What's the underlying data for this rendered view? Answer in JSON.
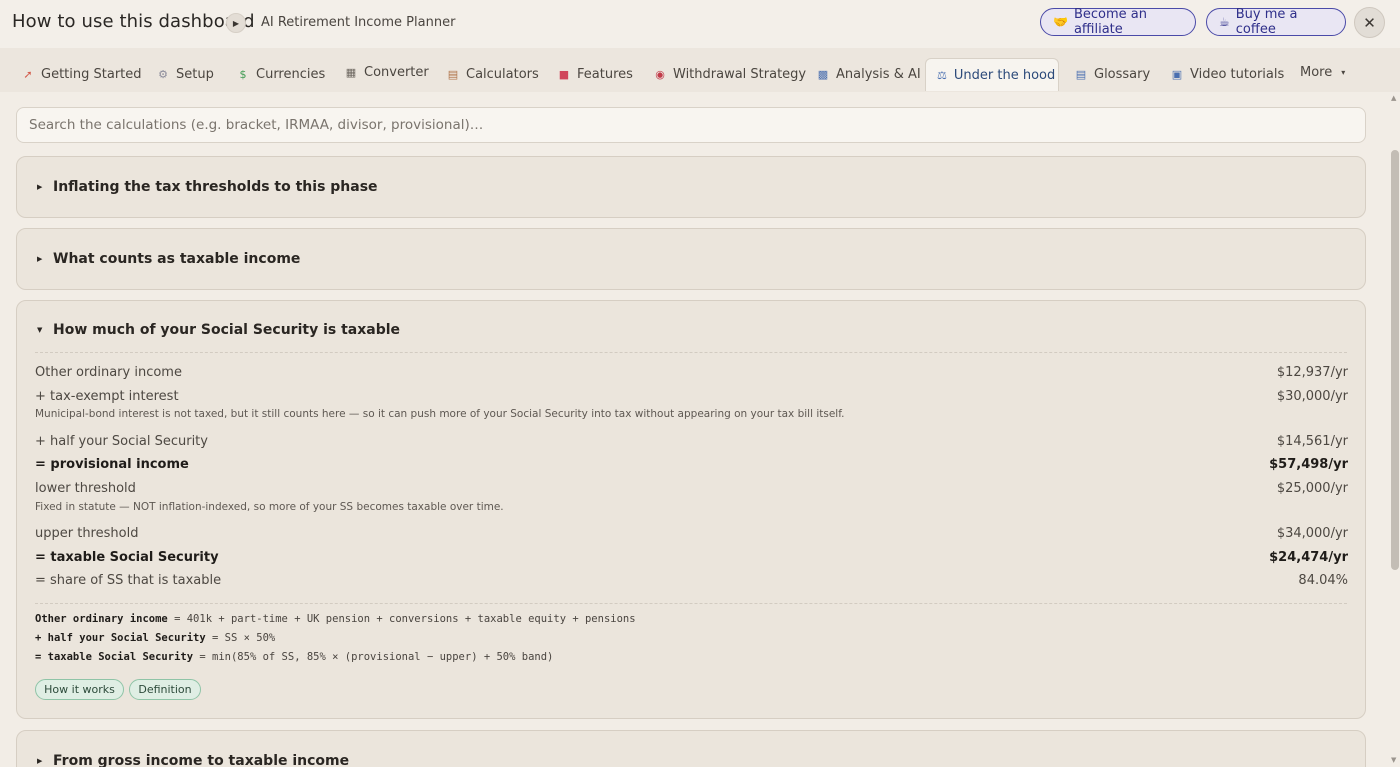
{
  "header": {
    "title": "How to use this dashboard",
    "subtitle": "AI Retirement Income Planner",
    "affiliate_label": "Become an affiliate",
    "coffee_label": "Buy me a coffee"
  },
  "tabs": [
    {
      "label": "Getting Started",
      "icon": "rocket-icon"
    },
    {
      "label": "Setup",
      "icon": "gear-icon"
    },
    {
      "label": "Currencies",
      "icon": "dollar-icon"
    },
    {
      "label": "Converter",
      "icon": "calculator-icon"
    },
    {
      "label": "Calculators",
      "icon": "abacus-icon"
    },
    {
      "label": "Features",
      "icon": "toolbox-icon"
    },
    {
      "label": "Withdrawal Strategy",
      "icon": "target-icon"
    },
    {
      "label": "Analysis & AI",
      "icon": "bar-chart-icon"
    },
    {
      "label": "Under the hood",
      "icon": "microscope-icon",
      "active": true
    },
    {
      "label": "Glossary",
      "icon": "book-icon"
    },
    {
      "label": "Video tutorials",
      "icon": "film-icon"
    },
    {
      "label": "More",
      "icon": "caret-down-icon"
    }
  ],
  "search": {
    "placeholder": "Search the calculations (e.g. bracket, IRMAA, divisor, provisional)…",
    "value": ""
  },
  "sections": [
    {
      "title": "Inflating the tax thresholds to this phase",
      "expanded": false
    },
    {
      "title": "What counts as taxable income",
      "expanded": false
    },
    {
      "title": "How much of your Social Security is taxable",
      "expanded": true
    },
    {
      "title": "From gross income to taxable income",
      "expanded": false
    }
  ],
  "ss_section": {
    "rows": [
      {
        "label": "Other ordinary income",
        "value": "$12,937/yr"
      },
      {
        "label": "+ tax-exempt interest",
        "value": "$30,000/yr"
      },
      {
        "label": "+ half your Social Security",
        "value": "$14,561/yr"
      },
      {
        "label": "= provisional income",
        "value": "$57,498/yr"
      },
      {
        "label": "lower threshold",
        "value": "$25,000/yr"
      },
      {
        "label": "upper threshold",
        "value": "$34,000/yr"
      },
      {
        "label": "= taxable Social Security",
        "value": "$24,474/yr"
      },
      {
        "label": "= share of SS that is taxable",
        "value": "84.04%"
      }
    ],
    "notes": {
      "muni_bond": "Municipal-bond interest is not taxed, but it still counts here — so it can push more of your Social Security into tax without appearing on your tax bill itself.",
      "lower_threshold": "Fixed in statute — NOT inflation-indexed, so more of your SS becomes taxable over time."
    },
    "formulas": [
      {
        "lhs": "Other ordinary income",
        "rhs": " = 401k + part-time + UK pension + conversions + taxable equity + pensions"
      },
      {
        "lhs": "+ half your Social Security",
        "rhs": " = SS × 50%"
      },
      {
        "lhs": "= taxable Social Security",
        "rhs": " = min(85% of SS, 85% × (provisional − upper) + 50% band)"
      }
    ],
    "tags": [
      "How it works",
      "Definition"
    ]
  }
}
